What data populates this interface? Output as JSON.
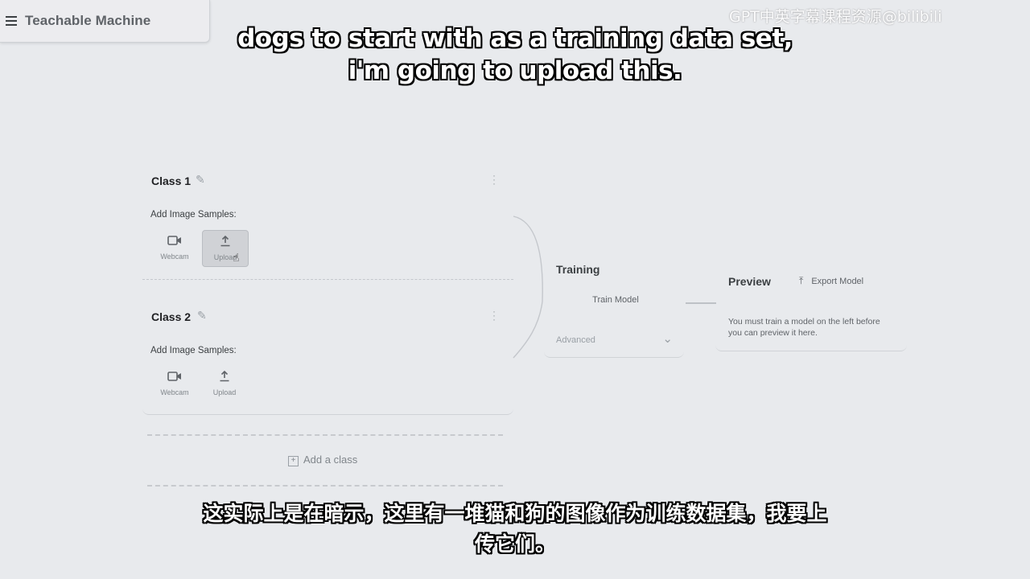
{
  "header": {
    "app_title": "Teachable Machine"
  },
  "watermark": "GPT中英字幕课程资源@bilibili",
  "subtitles": {
    "en_line1": "dogs to start with as a training data set,",
    "en_line2": "i'm going to upload this.",
    "zh_line1": "这实际上是在暗示，这里有一堆猫和狗的图像作为训练数据集，我要上",
    "zh_line2": "传它们。"
  },
  "classes": [
    {
      "name": "Class 1",
      "samples_label": "Add Image Samples:",
      "webcam_label": "Webcam",
      "upload_label": "Upload"
    },
    {
      "name": "Class 2",
      "samples_label": "Add Image Samples:",
      "webcam_label": "Webcam",
      "upload_label": "Upload"
    }
  ],
  "add_class_label": "Add a class",
  "training": {
    "title": "Training",
    "train_button": "Train Model",
    "advanced_label": "Advanced"
  },
  "preview": {
    "title": "Preview",
    "export_button": "Export Model",
    "message": "You must train a model on the left before you can preview it here."
  },
  "icons": {
    "menu": "menu-icon",
    "edit": "pencil-icon",
    "more": "more-vert-icon",
    "webcam": "videocam-icon",
    "upload": "upload-icon",
    "add": "add-box-icon",
    "chevron": "chevron-down-icon",
    "export": "export-icon"
  }
}
